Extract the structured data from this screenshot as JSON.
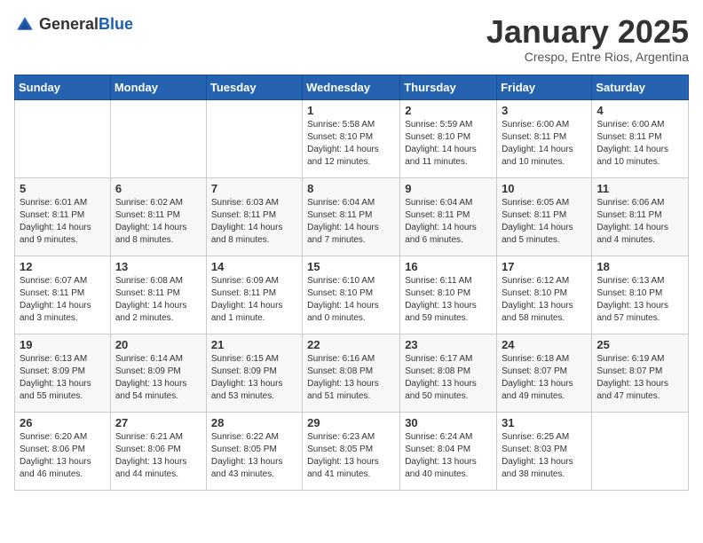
{
  "header": {
    "logo_general": "General",
    "logo_blue": "Blue",
    "month_title": "January 2025",
    "location": "Crespo, Entre Rios, Argentina"
  },
  "weekdays": [
    "Sunday",
    "Monday",
    "Tuesday",
    "Wednesday",
    "Thursday",
    "Friday",
    "Saturday"
  ],
  "weeks": [
    [
      {
        "day": "",
        "info": ""
      },
      {
        "day": "",
        "info": ""
      },
      {
        "day": "",
        "info": ""
      },
      {
        "day": "1",
        "info": "Sunrise: 5:58 AM\nSunset: 8:10 PM\nDaylight: 14 hours\nand 12 minutes."
      },
      {
        "day": "2",
        "info": "Sunrise: 5:59 AM\nSunset: 8:10 PM\nDaylight: 14 hours\nand 11 minutes."
      },
      {
        "day": "3",
        "info": "Sunrise: 6:00 AM\nSunset: 8:11 PM\nDaylight: 14 hours\nand 10 minutes."
      },
      {
        "day": "4",
        "info": "Sunrise: 6:00 AM\nSunset: 8:11 PM\nDaylight: 14 hours\nand 10 minutes."
      }
    ],
    [
      {
        "day": "5",
        "info": "Sunrise: 6:01 AM\nSunset: 8:11 PM\nDaylight: 14 hours\nand 9 minutes."
      },
      {
        "day": "6",
        "info": "Sunrise: 6:02 AM\nSunset: 8:11 PM\nDaylight: 14 hours\nand 8 minutes."
      },
      {
        "day": "7",
        "info": "Sunrise: 6:03 AM\nSunset: 8:11 PM\nDaylight: 14 hours\nand 8 minutes."
      },
      {
        "day": "8",
        "info": "Sunrise: 6:04 AM\nSunset: 8:11 PM\nDaylight: 14 hours\nand 7 minutes."
      },
      {
        "day": "9",
        "info": "Sunrise: 6:04 AM\nSunset: 8:11 PM\nDaylight: 14 hours\nand 6 minutes."
      },
      {
        "day": "10",
        "info": "Sunrise: 6:05 AM\nSunset: 8:11 PM\nDaylight: 14 hours\nand 5 minutes."
      },
      {
        "day": "11",
        "info": "Sunrise: 6:06 AM\nSunset: 8:11 PM\nDaylight: 14 hours\nand 4 minutes."
      }
    ],
    [
      {
        "day": "12",
        "info": "Sunrise: 6:07 AM\nSunset: 8:11 PM\nDaylight: 14 hours\nand 3 minutes."
      },
      {
        "day": "13",
        "info": "Sunrise: 6:08 AM\nSunset: 8:11 PM\nDaylight: 14 hours\nand 2 minutes."
      },
      {
        "day": "14",
        "info": "Sunrise: 6:09 AM\nSunset: 8:11 PM\nDaylight: 14 hours\nand 1 minute."
      },
      {
        "day": "15",
        "info": "Sunrise: 6:10 AM\nSunset: 8:10 PM\nDaylight: 14 hours\nand 0 minutes."
      },
      {
        "day": "16",
        "info": "Sunrise: 6:11 AM\nSunset: 8:10 PM\nDaylight: 13 hours\nand 59 minutes."
      },
      {
        "day": "17",
        "info": "Sunrise: 6:12 AM\nSunset: 8:10 PM\nDaylight: 13 hours\nand 58 minutes."
      },
      {
        "day": "18",
        "info": "Sunrise: 6:13 AM\nSunset: 8:10 PM\nDaylight: 13 hours\nand 57 minutes."
      }
    ],
    [
      {
        "day": "19",
        "info": "Sunrise: 6:13 AM\nSunset: 8:09 PM\nDaylight: 13 hours\nand 55 minutes."
      },
      {
        "day": "20",
        "info": "Sunrise: 6:14 AM\nSunset: 8:09 PM\nDaylight: 13 hours\nand 54 minutes."
      },
      {
        "day": "21",
        "info": "Sunrise: 6:15 AM\nSunset: 8:09 PM\nDaylight: 13 hours\nand 53 minutes."
      },
      {
        "day": "22",
        "info": "Sunrise: 6:16 AM\nSunset: 8:08 PM\nDaylight: 13 hours\nand 51 minutes."
      },
      {
        "day": "23",
        "info": "Sunrise: 6:17 AM\nSunset: 8:08 PM\nDaylight: 13 hours\nand 50 minutes."
      },
      {
        "day": "24",
        "info": "Sunrise: 6:18 AM\nSunset: 8:07 PM\nDaylight: 13 hours\nand 49 minutes."
      },
      {
        "day": "25",
        "info": "Sunrise: 6:19 AM\nSunset: 8:07 PM\nDaylight: 13 hours\nand 47 minutes."
      }
    ],
    [
      {
        "day": "26",
        "info": "Sunrise: 6:20 AM\nSunset: 8:06 PM\nDaylight: 13 hours\nand 46 minutes."
      },
      {
        "day": "27",
        "info": "Sunrise: 6:21 AM\nSunset: 8:06 PM\nDaylight: 13 hours\nand 44 minutes."
      },
      {
        "day": "28",
        "info": "Sunrise: 6:22 AM\nSunset: 8:05 PM\nDaylight: 13 hours\nand 43 minutes."
      },
      {
        "day": "29",
        "info": "Sunrise: 6:23 AM\nSunset: 8:05 PM\nDaylight: 13 hours\nand 41 minutes."
      },
      {
        "day": "30",
        "info": "Sunrise: 6:24 AM\nSunset: 8:04 PM\nDaylight: 13 hours\nand 40 minutes."
      },
      {
        "day": "31",
        "info": "Sunrise: 6:25 AM\nSunset: 8:03 PM\nDaylight: 13 hours\nand 38 minutes."
      },
      {
        "day": "",
        "info": ""
      }
    ]
  ]
}
